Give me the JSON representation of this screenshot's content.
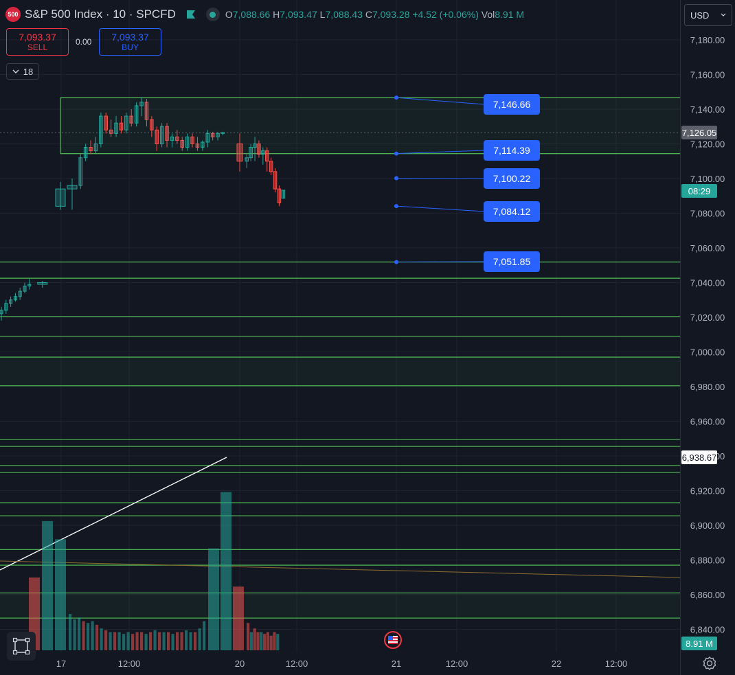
{
  "header": {
    "logo_text": "500",
    "symbol": "S&P 500 Index · 10 · SPCFD",
    "o_key": "O",
    "o_val": "7,088.66",
    "h_key": "H",
    "h_val": "7,093.47",
    "l_key": "L",
    "l_val": "7,088.43",
    "c_key": "C",
    "c_val": "7,093.28",
    "change": "+4.52 (+0.06%)",
    "vol_key": "Vol",
    "vol_val": "8.91 M"
  },
  "trade": {
    "sell_price": "7,093.37",
    "sell_label": "SELL",
    "spread": "0.00",
    "buy_price": "7,093.37",
    "buy_label": "BUY"
  },
  "indicator_count": "18",
  "currency": "USD",
  "colors": {
    "background": "#131722",
    "up": "#26a69a",
    "down": "#ef5350",
    "zone_line": "#4caf50",
    "label_blue": "#2962ff"
  },
  "chart_data": {
    "type": "candlestick",
    "y_axis": {
      "ticks": [
        "7,180.00",
        "7,160.00",
        "7,140.00",
        "7,120.00",
        "7,100.00",
        "7,080.00",
        "7,060.00",
        "7,040.00",
        "7,020.00",
        "7,000.00",
        "6,980.00",
        "6,960.00",
        "6,940.00",
        "6,920.00",
        "6,900.00",
        "6,880.00",
        "6,860.00",
        "6,840.00"
      ],
      "tick_values": [
        7180,
        7160,
        7140,
        7120,
        7100,
        7080,
        7060,
        7040,
        7020,
        7000,
        6980,
        6960,
        6940,
        6920,
        6900,
        6880,
        6860,
        6840
      ],
      "range": [
        6834,
        7198
      ]
    },
    "x_axis": {
      "ticks": [
        "17",
        "12:00",
        "20",
        "12:00",
        "21",
        "12:00",
        "22",
        "12:00"
      ]
    },
    "axis_badges": {
      "crosshair_price": "7,126.05",
      "countdown": "08:29",
      "line_price": "6,938.67",
      "volume": "8.91 M"
    },
    "price_labels": [
      "7,146.66",
      "7,114.39",
      "7,100.22",
      "7,084.12",
      "7,051.85"
    ],
    "price_label_values": [
      7146.66,
      7114.39,
      7100.22,
      7084.12,
      7051.85
    ],
    "horizontal_levels": [
      7146.66,
      7114.39,
      7051.85,
      7042.5,
      7020.5,
      7009,
      6997,
      6980.5,
      6949.5,
      6945.5,
      6934.5,
      6930.5,
      6913,
      6905.5,
      6886,
      6877,
      6861,
      6846.5
    ],
    "shaded_zones": [
      [
        7114.39,
        7146.66
      ],
      [
        6980.5,
        6997
      ],
      [
        6846.5,
        6861
      ]
    ],
    "candles_day1": [
      {
        "o": 7022,
        "h": 7026,
        "l": 7018,
        "c": 7024
      },
      {
        "o": 7024,
        "h": 7030,
        "l": 7022,
        "c": 7028
      },
      {
        "o": 7028,
        "h": 7032,
        "l": 7026,
        "c": 7030
      },
      {
        "o": 7030,
        "h": 7034,
        "l": 7029,
        "c": 7032
      },
      {
        "o": 7032,
        "h": 7037,
        "l": 7030,
        "c": 7035
      },
      {
        "o": 7035,
        "h": 7040,
        "l": 7034,
        "c": 7038
      },
      {
        "o": 7038,
        "h": 7042,
        "l": 7036,
        "c": 7039
      },
      {
        "o": 7039,
        "h": 7041,
        "l": 7037,
        "c": 7040
      }
    ],
    "candles_day2": [
      {
        "o": 7084,
        "h": 7098,
        "l": 7082,
        "c": 7094
      },
      {
        "o": 7094,
        "h": 7100,
        "l": 7082,
        "c": 7096
      },
      {
        "o": 7096,
        "h": 7114,
        "l": 7094,
        "c": 7112
      },
      {
        "o": 7112,
        "h": 7120,
        "l": 7110,
        "c": 7118
      },
      {
        "o": 7118,
        "h": 7122,
        "l": 7114,
        "c": 7116
      },
      {
        "o": 7116,
        "h": 7124,
        "l": 7114,
        "c": 7120
      },
      {
        "o": 7120,
        "h": 7138,
        "l": 7118,
        "c": 7136
      },
      {
        "o": 7136,
        "h": 7138,
        "l": 7126,
        "c": 7128
      },
      {
        "o": 7128,
        "h": 7134,
        "l": 7124,
        "c": 7126
      },
      {
        "o": 7126,
        "h": 7136,
        "l": 7124,
        "c": 7132
      },
      {
        "o": 7132,
        "h": 7136,
        "l": 7126,
        "c": 7128
      },
      {
        "o": 7128,
        "h": 7138,
        "l": 7126,
        "c": 7136
      },
      {
        "o": 7136,
        "h": 7140,
        "l": 7130,
        "c": 7132
      },
      {
        "o": 7132,
        "h": 7144,
        "l": 7130,
        "c": 7142
      },
      {
        "o": 7142,
        "h": 7147,
        "l": 7136,
        "c": 7144
      },
      {
        "o": 7144,
        "h": 7146,
        "l": 7130,
        "c": 7134
      },
      {
        "o": 7134,
        "h": 7136,
        "l": 7124,
        "c": 7128
      },
      {
        "o": 7128,
        "h": 7130,
        "l": 7116,
        "c": 7120
      },
      {
        "o": 7120,
        "h": 7132,
        "l": 7118,
        "c": 7130
      },
      {
        "o": 7130,
        "h": 7132,
        "l": 7118,
        "c": 7122
      },
      {
        "o": 7122,
        "h": 7126,
        "l": 7118,
        "c": 7124
      },
      {
        "o": 7124,
        "h": 7128,
        "l": 7120,
        "c": 7122
      },
      {
        "o": 7122,
        "h": 7124,
        "l": 7116,
        "c": 7118
      },
      {
        "o": 7118,
        "h": 7126,
        "l": 7116,
        "c": 7124
      },
      {
        "o": 7124,
        "h": 7126,
        "l": 7118,
        "c": 7120
      },
      {
        "o": 7120,
        "h": 7124,
        "l": 7116,
        "c": 7118
      },
      {
        "o": 7118,
        "h": 7122,
        "l": 7116,
        "c": 7121
      },
      {
        "o": 7121,
        "h": 7128,
        "l": 7118,
        "c": 7126
      },
      {
        "o": 7126,
        "h": 7127,
        "l": 7122,
        "c": 7124
      },
      {
        "o": 7124,
        "h": 7127,
        "l": 7122,
        "c": 7126
      },
      {
        "o": 7126,
        "h": 7127,
        "l": 7125,
        "c": 7126.5
      }
    ],
    "candles_day3": [
      {
        "o": 7120,
        "h": 7126,
        "l": 7104,
        "c": 7110
      },
      {
        "o": 7110,
        "h": 7114,
        "l": 7106,
        "c": 7112
      },
      {
        "o": 7112,
        "h": 7120,
        "l": 7110,
        "c": 7118
      },
      {
        "o": 7118,
        "h": 7124,
        "l": 7110,
        "c": 7120
      },
      {
        "o": 7120,
        "h": 7122,
        "l": 7112,
        "c": 7114
      },
      {
        "o": 7114,
        "h": 7118,
        "l": 7108,
        "c": 7116
      },
      {
        "o": 7116,
        "h": 7118,
        "l": 7104,
        "c": 7110
      },
      {
        "o": 7110,
        "h": 7112,
        "l": 7102,
        "c": 7104
      },
      {
        "o": 7104,
        "h": 7106,
        "l": 7092,
        "c": 7094
      },
      {
        "o": 7094,
        "h": 7096,
        "l": 7084,
        "c": 7086
      },
      {
        "o": 7088.66,
        "h": 7093.47,
        "l": 7088.43,
        "c": 7093.28
      }
    ],
    "volume_day1": [
      {
        "v": 0.4,
        "up": false
      },
      {
        "v": 0.71,
        "up": true
      },
      {
        "v": 0.61,
        "up": true
      }
    ],
    "volume_day2": [
      0.2,
      0.17,
      0.18,
      0.16,
      0.15,
      0.16,
      0.14,
      0.12,
      0.11,
      0.1,
      0.1,
      0.1,
      0.09,
      0.1,
      0.09,
      0.1,
      0.1,
      0.09,
      0.1,
      0.11,
      0.1,
      0.1,
      0.1,
      0.09,
      0.1,
      0.1,
      0.11,
      0.1,
      0.1,
      0.12,
      0.16
    ],
    "volume_day2_up": [
      true,
      true,
      true,
      false,
      true,
      true,
      false,
      true,
      false,
      true,
      false,
      true,
      true,
      true,
      false,
      false,
      false,
      true,
      false,
      true,
      false,
      true,
      false,
      true,
      false,
      false,
      true,
      true,
      false,
      true,
      true
    ],
    "volume_day2b": [
      {
        "v": 0.56,
        "up": true
      },
      {
        "v": 0.87,
        "up": true
      },
      {
        "v": 0.35,
        "up": false
      }
    ],
    "volume_day3": [
      0.15,
      0.1,
      0.12,
      0.1,
      0.1,
      0.09,
      0.1,
      0.08,
      0.1,
      0.09
    ],
    "volume_day3_up": [
      false,
      true,
      false,
      false,
      true,
      false,
      false,
      false,
      false,
      true
    ]
  }
}
